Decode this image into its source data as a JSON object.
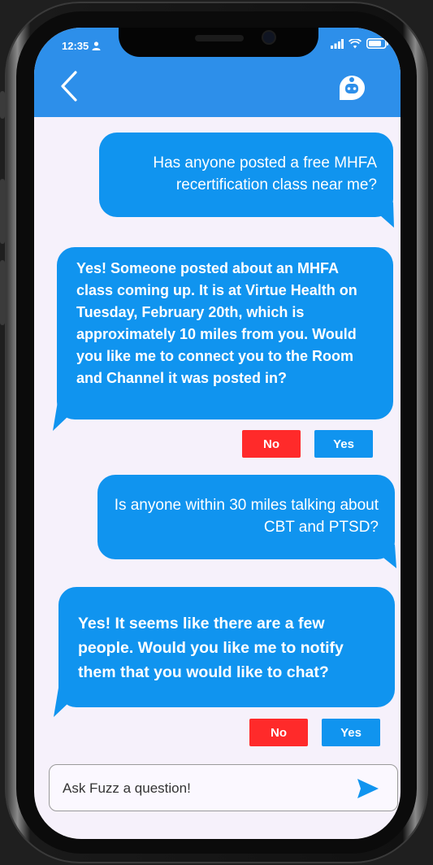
{
  "status_bar": {
    "time": "12:35"
  },
  "messages": [
    {
      "sender": "user",
      "text": "Has anyone posted a free MHFA recertification class near me?"
    },
    {
      "sender": "bot",
      "text": "Yes! Someone posted about an MHFA class coming up. It is at Virtue Health on Tuesday, February 20th, which is approximately 10 miles from you. Would you like me to connect you to the Room and Channel it was posted in?"
    },
    {
      "sender": "user",
      "text": "Is anyone within 30 miles talking about CBT and PTSD?"
    },
    {
      "sender": "bot",
      "text": "Yes! It seems like there are a few people. Would you like me to notify them that you would like to chat?"
    }
  ],
  "actions": [
    {
      "no": "No",
      "yes": "Yes"
    },
    {
      "no": "No",
      "yes": "Yes"
    }
  ],
  "composer": {
    "placeholder": "Ask Fuzz a question!"
  },
  "colors": {
    "header": "#2d8fea",
    "bubble": "#1094ef",
    "no_button": "#ff2a2a",
    "background": "#f6f1fb"
  },
  "icons": [
    "back-chevron-icon",
    "chatbot-icon",
    "person-icon",
    "signal-icon",
    "wifi-icon",
    "battery-icon",
    "send-icon"
  ]
}
